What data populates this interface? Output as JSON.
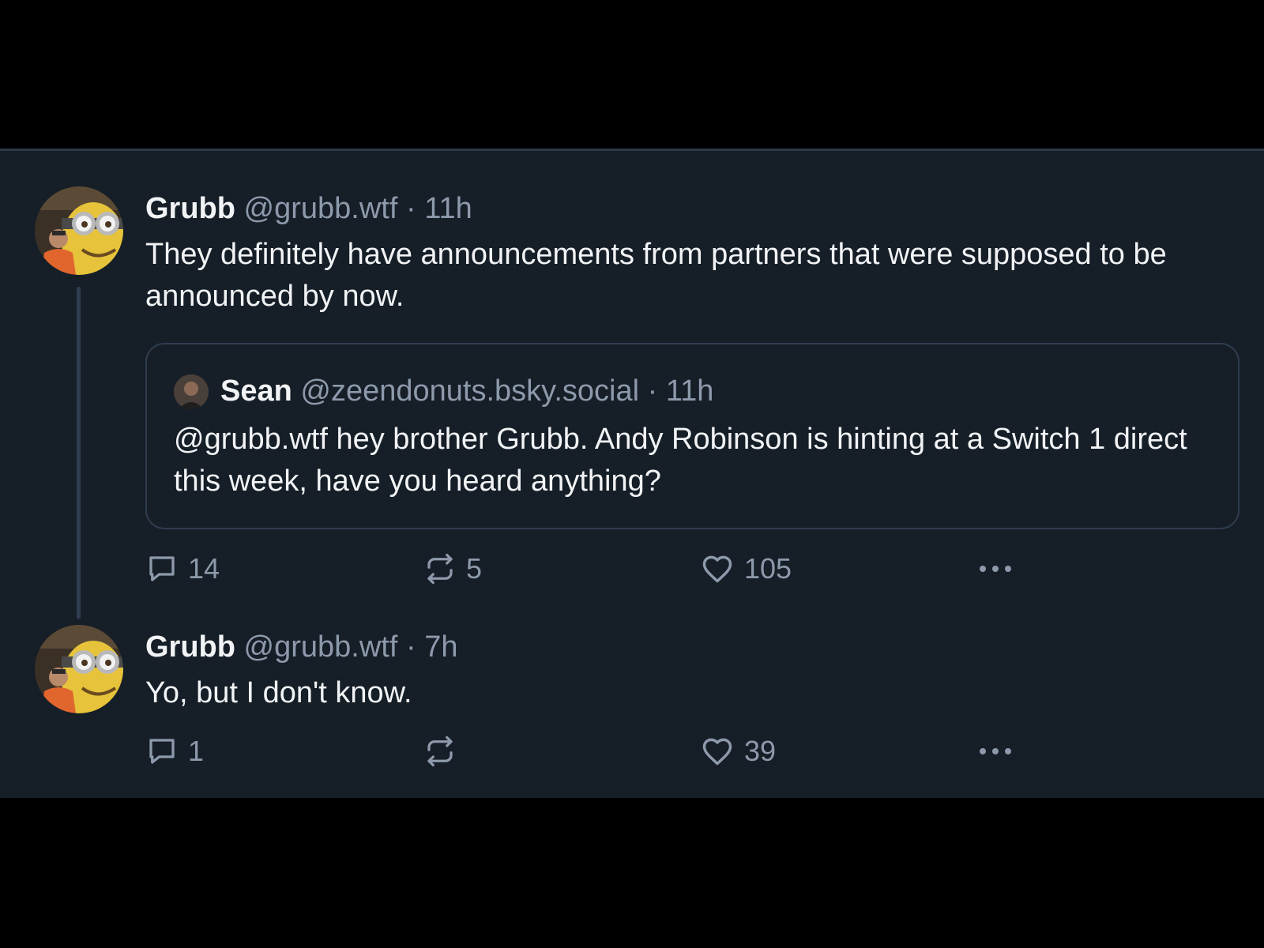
{
  "thread": {
    "posts": [
      {
        "author": {
          "name": "Grubb",
          "handle": "@grubb.wtf"
        },
        "separator": "·",
        "time": "11h",
        "text": "They definitely have announcements from partners that were supposed to be announced by now.",
        "quote": {
          "author": {
            "name": "Sean",
            "handle": "@zeendonuts.bsky.social"
          },
          "separator": "·",
          "time": "11h",
          "text": "@grubb.wtf hey brother Grubb. Andy Robinson is hinting at a Switch 1 direct this week, have you heard anything?"
        },
        "actions": {
          "replies": "14",
          "reposts": "5",
          "likes": "105"
        }
      },
      {
        "author": {
          "name": "Grubb",
          "handle": "@grubb.wtf"
        },
        "separator": "·",
        "time": "7h",
        "text": "Yo, but I don't know.",
        "actions": {
          "replies": "1",
          "reposts": "",
          "likes": "39"
        }
      }
    ]
  },
  "icons": {
    "reply": "speech-bubble-icon",
    "repost": "repost-arrows-icon",
    "like": "heart-icon",
    "more": "ellipsis-icon"
  },
  "colors": {
    "background": "#161e27",
    "text": "#f1f3f5",
    "muted": "#8d9aab",
    "border": "#2e3d4e"
  }
}
